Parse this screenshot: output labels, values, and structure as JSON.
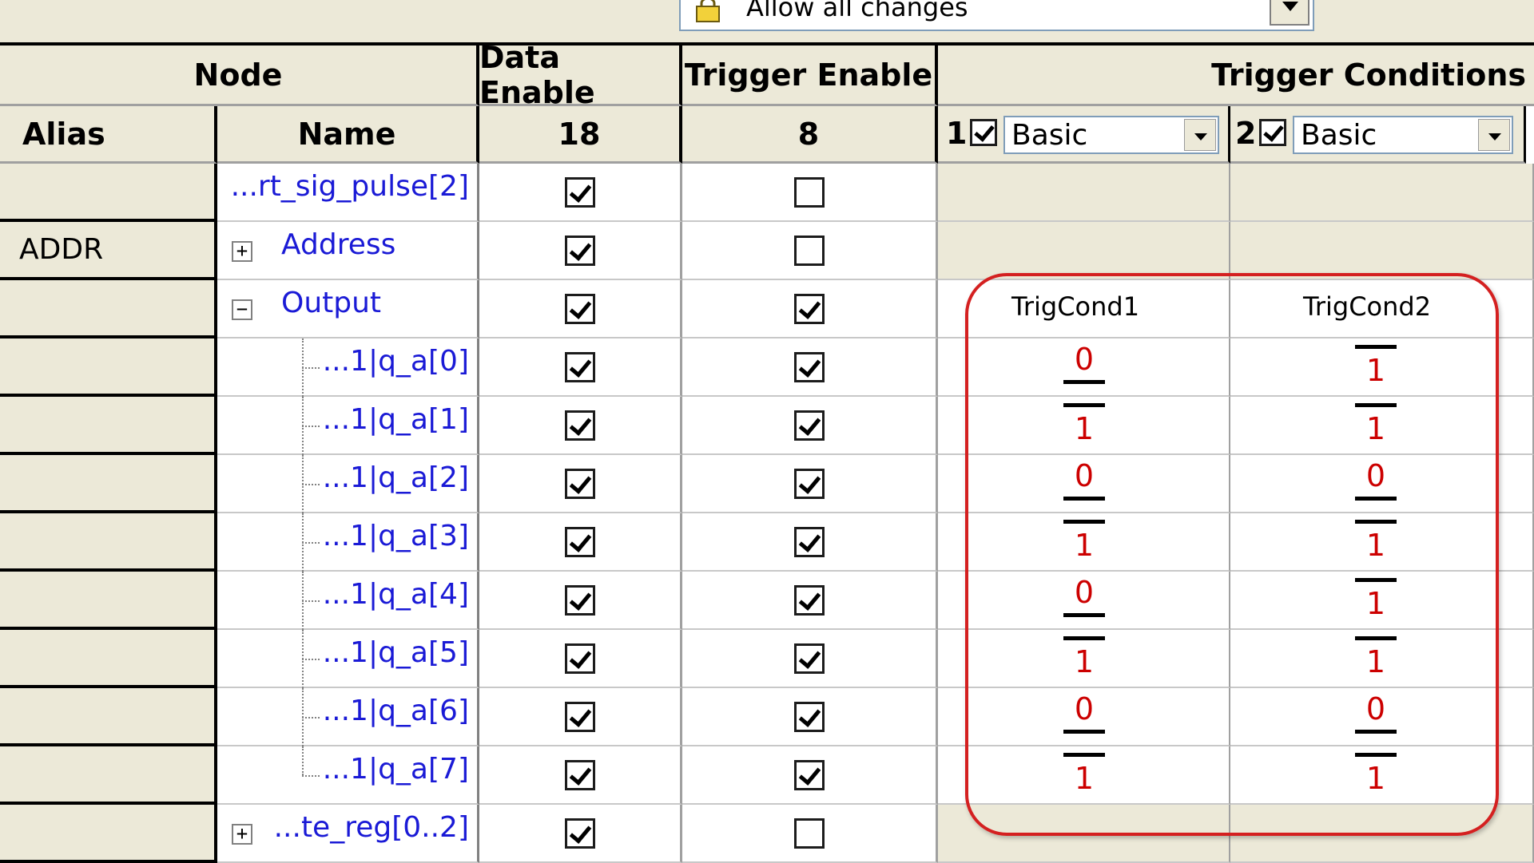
{
  "toolbar": {
    "lock_mode": "Allow all changes",
    "lock_icon": "lock-icon"
  },
  "header": {
    "node": "Node",
    "data_enable": "Data Enable",
    "trigger_enable": "Trigger Enable",
    "trigger_conditions": "Trigger Conditions",
    "alias": "Alias",
    "name": "Name",
    "data_enable_count": "18",
    "trigger_enable_count": "8",
    "tc1": {
      "number": "1",
      "enabled": true,
      "type": "Basic"
    },
    "tc2": {
      "number": "2",
      "enabled": true,
      "type": "Basic"
    }
  },
  "rows": [
    {
      "alias": "",
      "name": "...rt_sig_pulse[2]",
      "data_enable": true,
      "trigger_enable": false,
      "expander": ""
    },
    {
      "alias": "ADDR",
      "name": "Address",
      "data_enable": true,
      "trigger_enable": false,
      "expander": "+"
    },
    {
      "alias": "",
      "name": "Output",
      "data_enable": true,
      "trigger_enable": true,
      "expander": "−",
      "tc1_label": "TrigCond1",
      "tc2_label": "TrigCond2"
    },
    {
      "alias": "",
      "name": "...1|q_a[0]",
      "data_enable": true,
      "trigger_enable": true,
      "tc1": "0",
      "tc2": "1"
    },
    {
      "alias": "",
      "name": "...1|q_a[1]",
      "data_enable": true,
      "trigger_enable": true,
      "tc1": "1",
      "tc2": "1"
    },
    {
      "alias": "",
      "name": "...1|q_a[2]",
      "data_enable": true,
      "trigger_enable": true,
      "tc1": "0",
      "tc2": "0"
    },
    {
      "alias": "",
      "name": "...1|q_a[3]",
      "data_enable": true,
      "trigger_enable": true,
      "tc1": "1",
      "tc2": "1"
    },
    {
      "alias": "",
      "name": "...1|q_a[4]",
      "data_enable": true,
      "trigger_enable": true,
      "tc1": "0",
      "tc2": "1"
    },
    {
      "alias": "",
      "name": "...1|q_a[5]",
      "data_enable": true,
      "trigger_enable": true,
      "tc1": "1",
      "tc2": "1"
    },
    {
      "alias": "",
      "name": "...1|q_a[6]",
      "data_enable": true,
      "trigger_enable": true,
      "tc1": "0",
      "tc2": "0"
    },
    {
      "alias": "",
      "name": "...1|q_a[7]",
      "data_enable": true,
      "trigger_enable": true,
      "tc1": "1",
      "tc2": "1"
    },
    {
      "alias": "",
      "name": "...te_reg[0..2]",
      "data_enable": true,
      "trigger_enable": false,
      "expander": "+"
    }
  ],
  "colors": {
    "highlight": "#d42020",
    "bit_value": "#cc0000",
    "node_name": "#1a1ad6",
    "panel": "#ece9d8"
  }
}
